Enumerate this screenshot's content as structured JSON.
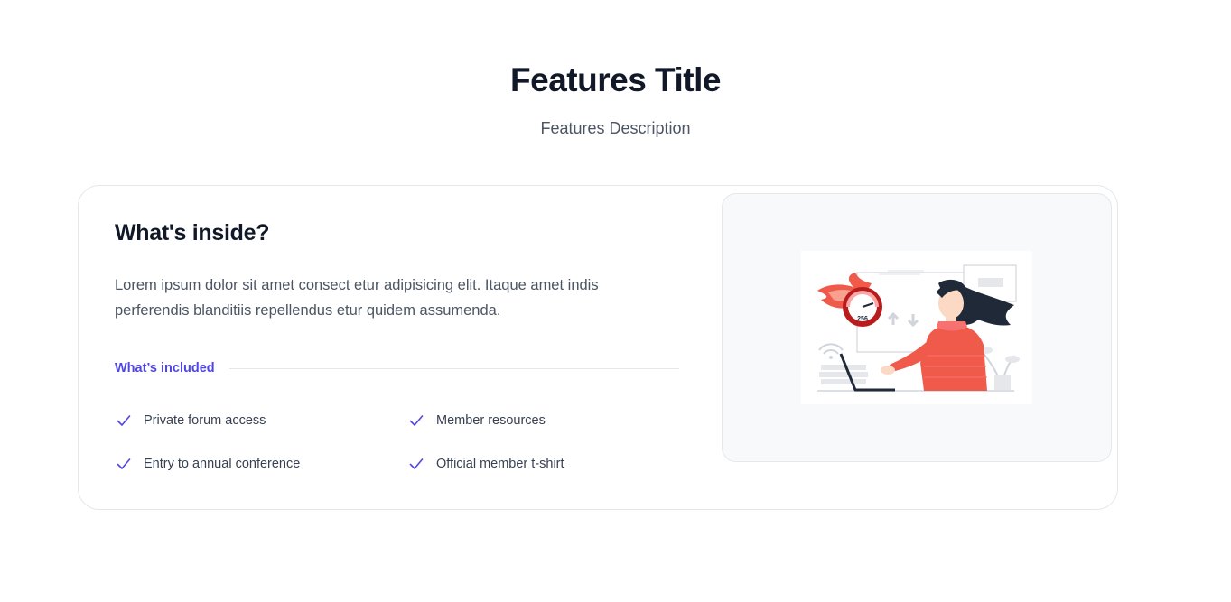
{
  "header": {
    "title": "Features Title",
    "description": "Features Description"
  },
  "card": {
    "heading": "What's inside?",
    "text": "Lorem ipsum dolor sit amet consect etur adipisicing elit. Itaque amet indis perferendis blanditiis repellendus etur quidem assumenda.",
    "included_label": "What’s included",
    "features": [
      {
        "label": "Private forum access",
        "icon": "check-icon"
      },
      {
        "label": "Member resources",
        "icon": "check-icon"
      },
      {
        "label": "Entry to annual conference",
        "icon": "check-icon"
      },
      {
        "label": "Official member t-shirt",
        "icon": "check-icon"
      }
    ]
  },
  "illustration": {
    "gauge_value": "256"
  },
  "colors": {
    "accent": "#4f46e5",
    "heading": "#111827",
    "body_text": "#4b5563",
    "illustration_red": "#ef5a4a"
  }
}
